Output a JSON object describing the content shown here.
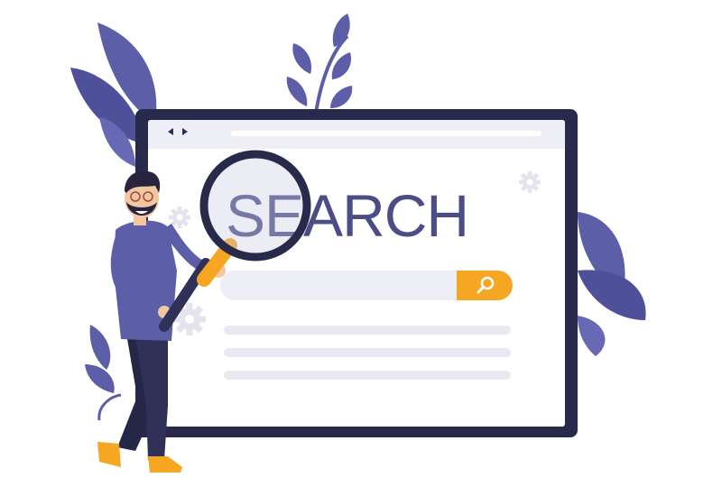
{
  "illustration": {
    "search_word": "SEARCH",
    "colors": {
      "frame": "#272a4a",
      "accent": "#f5a623",
      "leaf": "#5c5ea8",
      "text": "#4b4e86",
      "line": "#e9e9f3"
    },
    "icons": [
      "leaf-icon",
      "gear-icon",
      "magnifier-icon",
      "back-arrow-icon",
      "forward-arrow-icon"
    ]
  }
}
